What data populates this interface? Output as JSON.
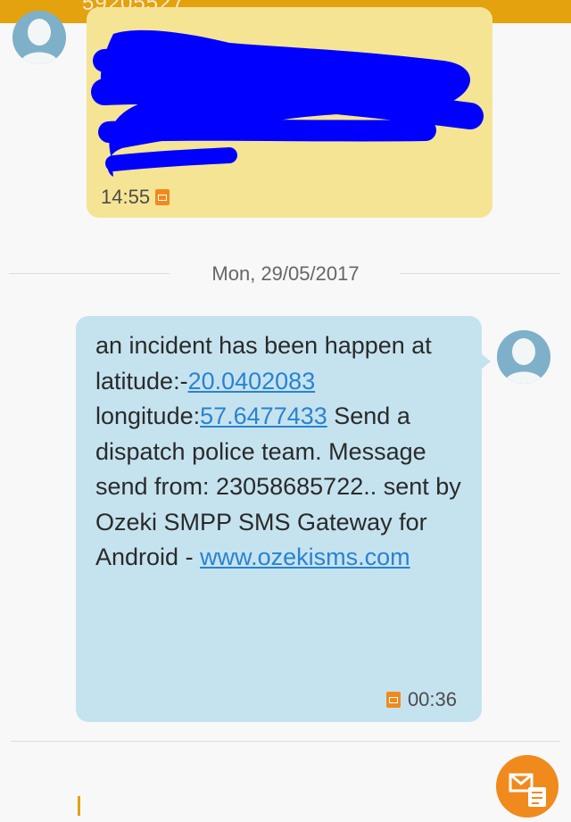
{
  "header": {
    "partial_number": "59205527",
    "color": "#e3a20e"
  },
  "incoming_message": {
    "time": "14:55",
    "sim_icon": "sim-icon",
    "bubble_color": "#f5e493",
    "redacted": true
  },
  "date_separator": {
    "label": "Mon, 29/05/2017"
  },
  "outgoing_message": {
    "text_before": "an incident has been happen at latitude:-",
    "latitude_link": "20.0402083",
    "text_middle": " longitude:",
    "longitude_link": "57.6477433",
    "text_after": " Send a dispatch police team. Message send from: 23058685722.. sent by Ozeki SMPP SMS Gateway for Android - ",
    "website_link": "www.ozekisms.com",
    "time": "00:36",
    "sim_icon": "sim-icon",
    "bubble_color": "#c5e3ef",
    "link_color": "#2a82d0"
  },
  "compose": {
    "send_icon": "send-mms-icon",
    "accent": "#f08a1c"
  }
}
